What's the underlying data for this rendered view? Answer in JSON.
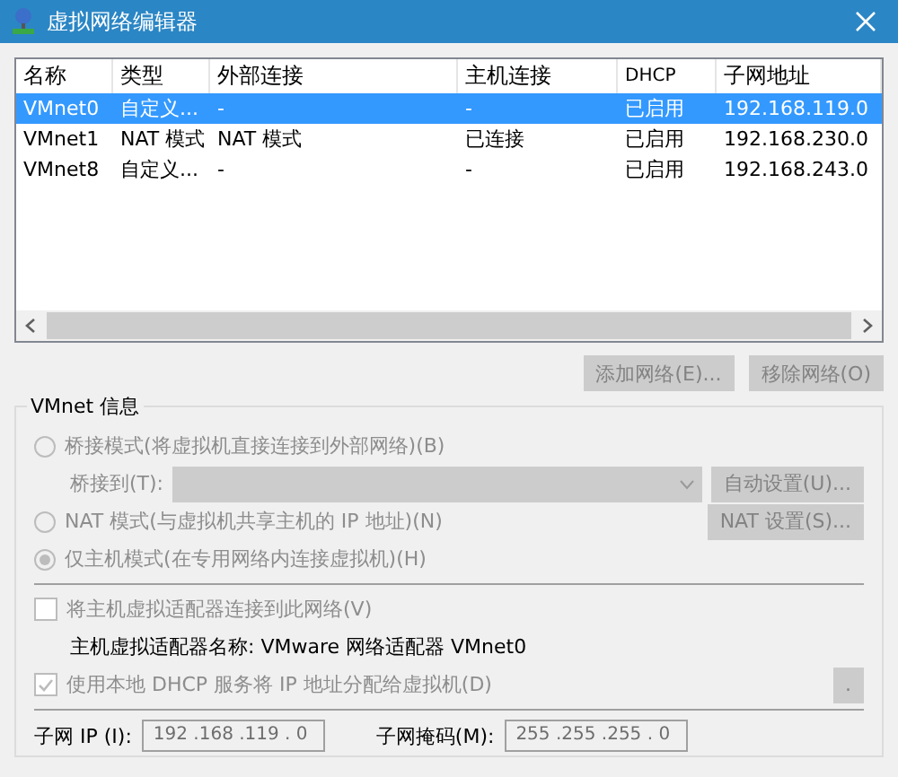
{
  "window": {
    "title": "虚拟网络编辑器"
  },
  "table": {
    "columns": [
      "名称",
      "类型",
      "外部连接",
      "主机连接",
      "DHCP",
      "子网地址"
    ],
    "rows": [
      {
        "cells": [
          "VMnet0",
          "自定义...",
          "-",
          "-",
          "已启用",
          "192.168.119.0"
        ],
        "selected": true
      },
      {
        "cells": [
          "VMnet1",
          "NAT 模式",
          "NAT 模式",
          "已连接",
          "已启用",
          "192.168.230.0"
        ],
        "selected": false
      },
      {
        "cells": [
          "VMnet8",
          "自定义...",
          "-",
          "-",
          "已启用",
          "192.168.243.0"
        ],
        "selected": false
      }
    ]
  },
  "list_buttons": [
    {
      "label": "添加网络(E)...",
      "disabled": true
    },
    {
      "label": "移除网络(O)",
      "disabled": true
    }
  ],
  "vmnet_info": {
    "title": "VMnet 信息",
    "rows": [
      {
        "kind": "radio",
        "label": "桥接模式(将虚拟机直接连接到外部网络)(B)",
        "selected": false,
        "disabled": true
      },
      {
        "kind": "dropdown",
        "label": "桥接到(T):",
        "disabled": true,
        "button": {
          "label": "自动设置(U)...",
          "disabled": true
        }
      },
      {
        "kind": "radio",
        "label": "NAT 模式(与虚拟机共享主机的 IP 地址)(N)",
        "selected": false,
        "disabled": true,
        "button": {
          "label": "NAT 设置(S)...",
          "disabled": true
        }
      },
      {
        "kind": "radio",
        "label": "仅主机模式(在专用网络内连接虚拟机)(H)",
        "selected": true,
        "disabled": true
      },
      {
        "kind": "divider"
      },
      {
        "kind": "checkbox",
        "label": "将主机虚拟适配器连接到此网络(V)",
        "checked": false,
        "disabled": true
      },
      {
        "kind": "text",
        "label": "主机虚拟适配器名称: VMware 网络适配器 VMnet0"
      },
      {
        "kind": "checkbox",
        "label": "使用本地 DHCP 服务将 IP 地址分配给虚拟机(D)",
        "checked": true,
        "disabled": true,
        "button": {
          "label": ".",
          "disabled": true
        }
      },
      {
        "kind": "divider"
      },
      {
        "kind": "fields",
        "fields": [
          {
            "label": "子网 IP (I):",
            "value": "192 .168 .119 .  0"
          },
          {
            "label": "子网掩码(M):",
            "value": "255 .255 .255 .  0"
          }
        ]
      }
    ]
  }
}
